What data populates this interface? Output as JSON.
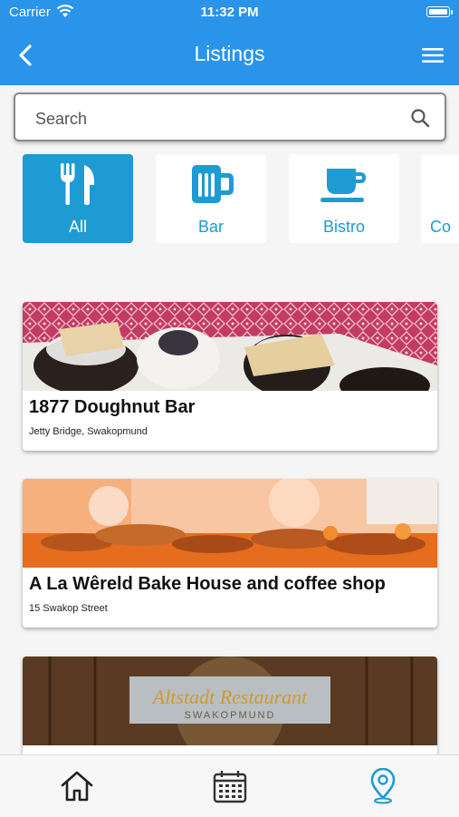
{
  "status_bar": {
    "carrier": "Carrier",
    "time": "11:32 PM"
  },
  "nav": {
    "title": "Listings"
  },
  "search": {
    "placeholder": "Search"
  },
  "categories": [
    {
      "label": "All",
      "icon": "utensils-icon",
      "active": true
    },
    {
      "label": "Bar",
      "icon": "beer-mug-icon",
      "active": false
    },
    {
      "label": "Bistro",
      "icon": "coffee-cup-icon",
      "active": false
    },
    {
      "label": "Co",
      "icon": "coffee-icon",
      "active": false
    }
  ],
  "listings": [
    {
      "name": "1877 Doughnut Bar",
      "address": "Jetty Bridge, Swakopmund"
    },
    {
      "name": "A La Wêreld Bake House and coffee shop",
      "address": "15 Swakop Street"
    },
    {
      "name": "",
      "address": "",
      "image_text": [
        "Altstadt Restaurant",
        "SWAKOPMUND"
      ]
    }
  ],
  "tabs": [
    "home-icon",
    "calendar-icon",
    "map-pin-icon"
  ],
  "colors": {
    "primary": "#2a93ea",
    "accent": "#1e9bd3"
  }
}
